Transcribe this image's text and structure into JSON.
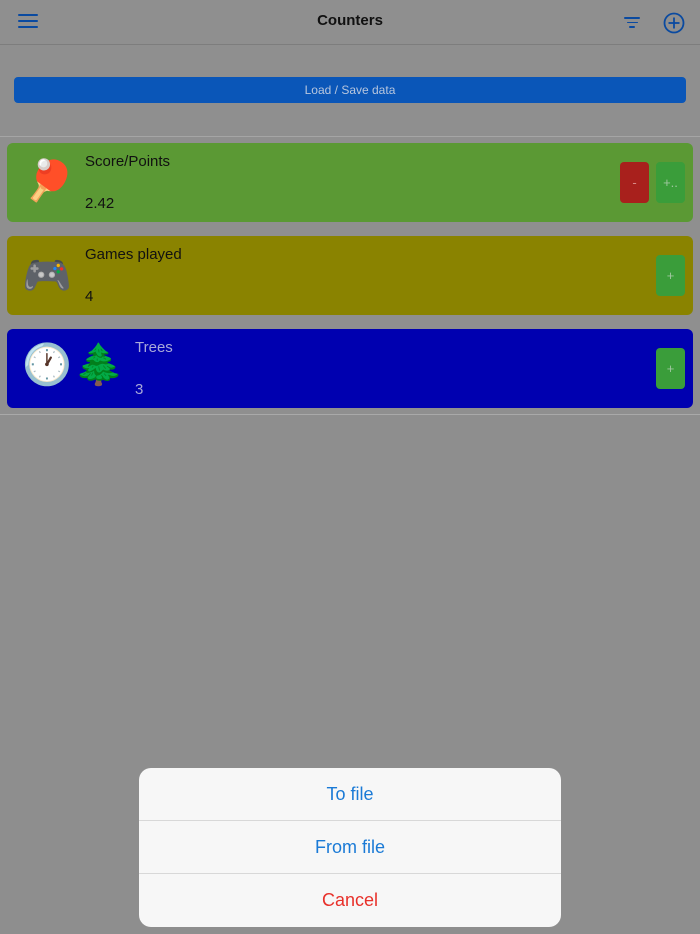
{
  "header": {
    "title": "Counters",
    "menu_icon": "hamburger-menu-icon",
    "filter_icon": "filter-icon",
    "add_icon": "plus-circle-icon",
    "accent_color": "#0a4aa0"
  },
  "load_save": {
    "label": "Load / Save data",
    "color": "#0a56b8"
  },
  "counters": [
    {
      "name": "Score/Points",
      "value": "2.42",
      "icons": [
        "🏓"
      ],
      "icon_names": [
        "ping-pong-icon"
      ],
      "color": "#5b9934",
      "minus_label": "-",
      "plus_label": "+.."
    },
    {
      "name": "Games played",
      "value": "4",
      "icons": [
        "🎮"
      ],
      "icon_names": [
        "game-controller-icon"
      ],
      "color": "#8a8300",
      "plus_label": "+"
    },
    {
      "name": "Trees",
      "value": "3",
      "icons": [
        "🕐",
        "🌲"
      ],
      "icon_names": [
        "clock-icon",
        "tree-icon"
      ],
      "color": "#0000b0",
      "plus_label": "+"
    }
  ],
  "action_sheet": {
    "items": [
      {
        "label": "To file"
      },
      {
        "label": "From file"
      },
      {
        "label": "Cancel"
      }
    ]
  }
}
